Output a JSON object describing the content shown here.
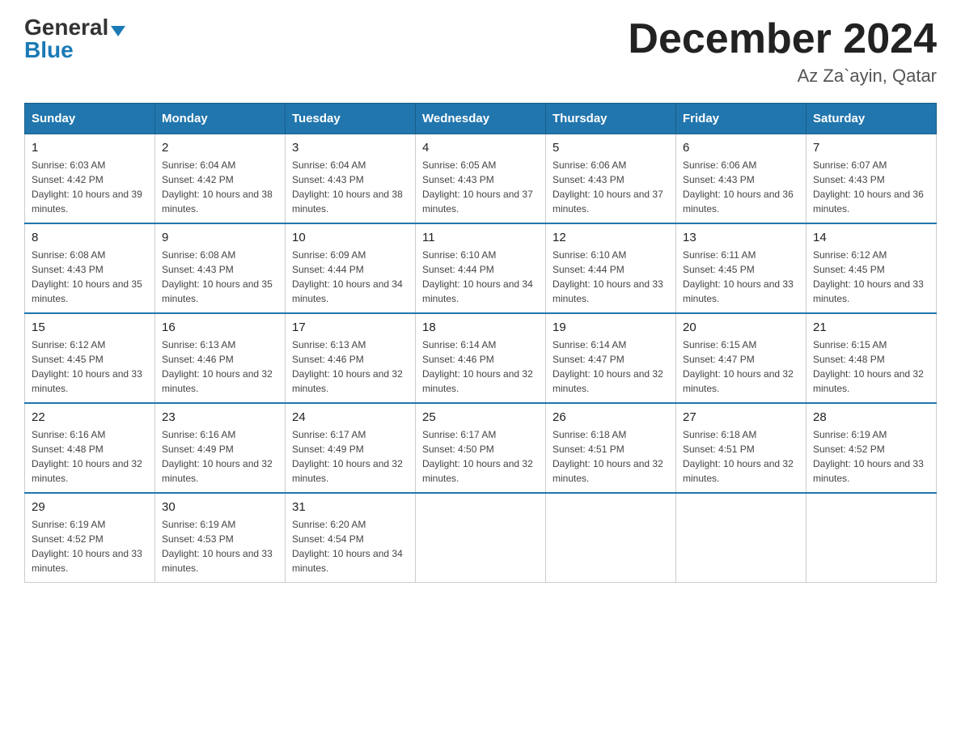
{
  "logo": {
    "general": "General",
    "blue": "Blue",
    "triangle": "▶"
  },
  "title": "December 2024",
  "subtitle": "Az Za`ayin, Qatar",
  "days_of_week": [
    "Sunday",
    "Monday",
    "Tuesday",
    "Wednesday",
    "Thursday",
    "Friday",
    "Saturday"
  ],
  "weeks": [
    [
      {
        "day": "1",
        "sunrise": "6:03 AM",
        "sunset": "4:42 PM",
        "daylight": "10 hours and 39 minutes."
      },
      {
        "day": "2",
        "sunrise": "6:04 AM",
        "sunset": "4:42 PM",
        "daylight": "10 hours and 38 minutes."
      },
      {
        "day": "3",
        "sunrise": "6:04 AM",
        "sunset": "4:43 PM",
        "daylight": "10 hours and 38 minutes."
      },
      {
        "day": "4",
        "sunrise": "6:05 AM",
        "sunset": "4:43 PM",
        "daylight": "10 hours and 37 minutes."
      },
      {
        "day": "5",
        "sunrise": "6:06 AM",
        "sunset": "4:43 PM",
        "daylight": "10 hours and 37 minutes."
      },
      {
        "day": "6",
        "sunrise": "6:06 AM",
        "sunset": "4:43 PM",
        "daylight": "10 hours and 36 minutes."
      },
      {
        "day": "7",
        "sunrise": "6:07 AM",
        "sunset": "4:43 PM",
        "daylight": "10 hours and 36 minutes."
      }
    ],
    [
      {
        "day": "8",
        "sunrise": "6:08 AM",
        "sunset": "4:43 PM",
        "daylight": "10 hours and 35 minutes."
      },
      {
        "day": "9",
        "sunrise": "6:08 AM",
        "sunset": "4:43 PM",
        "daylight": "10 hours and 35 minutes."
      },
      {
        "day": "10",
        "sunrise": "6:09 AM",
        "sunset": "4:44 PM",
        "daylight": "10 hours and 34 minutes."
      },
      {
        "day": "11",
        "sunrise": "6:10 AM",
        "sunset": "4:44 PM",
        "daylight": "10 hours and 34 minutes."
      },
      {
        "day": "12",
        "sunrise": "6:10 AM",
        "sunset": "4:44 PM",
        "daylight": "10 hours and 33 minutes."
      },
      {
        "day": "13",
        "sunrise": "6:11 AM",
        "sunset": "4:45 PM",
        "daylight": "10 hours and 33 minutes."
      },
      {
        "day": "14",
        "sunrise": "6:12 AM",
        "sunset": "4:45 PM",
        "daylight": "10 hours and 33 minutes."
      }
    ],
    [
      {
        "day": "15",
        "sunrise": "6:12 AM",
        "sunset": "4:45 PM",
        "daylight": "10 hours and 33 minutes."
      },
      {
        "day": "16",
        "sunrise": "6:13 AM",
        "sunset": "4:46 PM",
        "daylight": "10 hours and 32 minutes."
      },
      {
        "day": "17",
        "sunrise": "6:13 AM",
        "sunset": "4:46 PM",
        "daylight": "10 hours and 32 minutes."
      },
      {
        "day": "18",
        "sunrise": "6:14 AM",
        "sunset": "4:46 PM",
        "daylight": "10 hours and 32 minutes."
      },
      {
        "day": "19",
        "sunrise": "6:14 AM",
        "sunset": "4:47 PM",
        "daylight": "10 hours and 32 minutes."
      },
      {
        "day": "20",
        "sunrise": "6:15 AM",
        "sunset": "4:47 PM",
        "daylight": "10 hours and 32 minutes."
      },
      {
        "day": "21",
        "sunrise": "6:15 AM",
        "sunset": "4:48 PM",
        "daylight": "10 hours and 32 minutes."
      }
    ],
    [
      {
        "day": "22",
        "sunrise": "6:16 AM",
        "sunset": "4:48 PM",
        "daylight": "10 hours and 32 minutes."
      },
      {
        "day": "23",
        "sunrise": "6:16 AM",
        "sunset": "4:49 PM",
        "daylight": "10 hours and 32 minutes."
      },
      {
        "day": "24",
        "sunrise": "6:17 AM",
        "sunset": "4:49 PM",
        "daylight": "10 hours and 32 minutes."
      },
      {
        "day": "25",
        "sunrise": "6:17 AM",
        "sunset": "4:50 PM",
        "daylight": "10 hours and 32 minutes."
      },
      {
        "day": "26",
        "sunrise": "6:18 AM",
        "sunset": "4:51 PM",
        "daylight": "10 hours and 32 minutes."
      },
      {
        "day": "27",
        "sunrise": "6:18 AM",
        "sunset": "4:51 PM",
        "daylight": "10 hours and 32 minutes."
      },
      {
        "day": "28",
        "sunrise": "6:19 AM",
        "sunset": "4:52 PM",
        "daylight": "10 hours and 33 minutes."
      }
    ],
    [
      {
        "day": "29",
        "sunrise": "6:19 AM",
        "sunset": "4:52 PM",
        "daylight": "10 hours and 33 minutes."
      },
      {
        "day": "30",
        "sunrise": "6:19 AM",
        "sunset": "4:53 PM",
        "daylight": "10 hours and 33 minutes."
      },
      {
        "day": "31",
        "sunrise": "6:20 AM",
        "sunset": "4:54 PM",
        "daylight": "10 hours and 34 minutes."
      },
      null,
      null,
      null,
      null
    ]
  ]
}
